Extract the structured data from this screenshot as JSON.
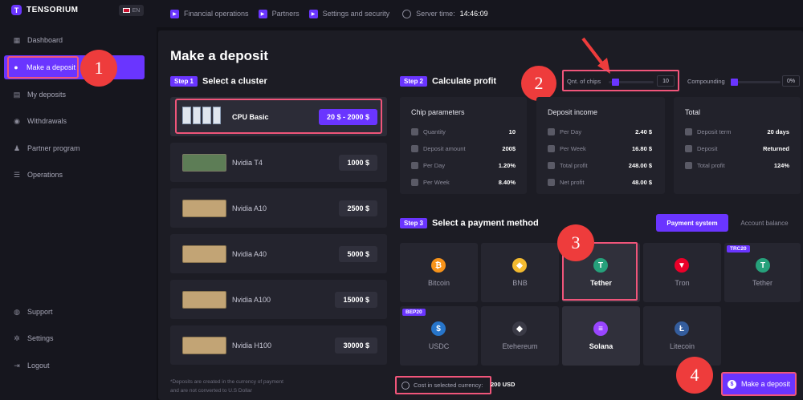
{
  "app": {
    "name": "TENSORIUM",
    "lang": "EN"
  },
  "sidebar": {
    "items": [
      {
        "label": "Dashboard",
        "icon": "dashboard-icon"
      },
      {
        "label": "Make a deposit",
        "icon": "deposit-icon",
        "active": true
      },
      {
        "label": "My deposits",
        "icon": "wallet-icon"
      },
      {
        "label": "Withdrawals",
        "icon": "withdraw-icon"
      },
      {
        "label": "Partner program",
        "icon": "users-icon"
      },
      {
        "label": "Operations",
        "icon": "list-icon"
      }
    ],
    "bottom": [
      {
        "label": "Support",
        "icon": "support-icon"
      },
      {
        "label": "Settings",
        "icon": "gear-icon"
      },
      {
        "label": "Logout",
        "icon": "logout-icon"
      }
    ]
  },
  "topbar": {
    "links": [
      "Financial operations",
      "Partners",
      "Settings and security"
    ],
    "server_time_label": "Server time:",
    "server_time": "14:46:09"
  },
  "page": {
    "title": "Make a deposit"
  },
  "step1": {
    "tag": "Step 1",
    "title": "Select a cluster"
  },
  "clusters": [
    {
      "name": "CPU Basic",
      "price": "20 $ - 2000 $",
      "selected": true
    },
    {
      "name": "Nvidia T4",
      "price": "1000 $"
    },
    {
      "name": "Nvidia A10",
      "price": "2500 $"
    },
    {
      "name": "Nvidia A40",
      "price": "5000 $"
    },
    {
      "name": "Nvidia A100",
      "price": "15000 $"
    },
    {
      "name": "Nvidia H100",
      "price": "30000 $"
    }
  ],
  "step2": {
    "tag": "Step 2",
    "title": "Calculate profit"
  },
  "controls": {
    "chips_label": "Qnt. of chips",
    "chips_value": "10",
    "compounding_label": "Compounding",
    "compounding_value": "0%"
  },
  "panels": {
    "chip": {
      "title": "Chip parameters",
      "rows": [
        {
          "label": "Quantity",
          "value": "10"
        },
        {
          "label": "Deposit amount",
          "value": "200$"
        },
        {
          "label": "Per Day",
          "value": "1.20%"
        },
        {
          "label": "Per Week",
          "value": "8.40%"
        }
      ]
    },
    "income": {
      "title": "Deposit income",
      "rows": [
        {
          "label": "Per Day",
          "value": "2.40 $"
        },
        {
          "label": "Per Week",
          "value": "16.80 $"
        },
        {
          "label": "Total profit",
          "value": "248.00 $"
        },
        {
          "label": "Net profit",
          "value": "48.00 $"
        }
      ]
    },
    "total": {
      "title": "Total",
      "rows": [
        {
          "label": "Deposit term",
          "value": "20 days"
        },
        {
          "label": "Deposit",
          "value": "Returned"
        },
        {
          "label": "Total profit",
          "value": "124%"
        }
      ]
    }
  },
  "step3": {
    "tag": "Step 3",
    "title": "Select a payment method"
  },
  "payment_tabs": [
    "Payment system",
    "Account balance"
  ],
  "payments": [
    {
      "name": "Bitcoin",
      "glyph": "₿",
      "color": "#f7931a"
    },
    {
      "name": "BNB",
      "glyph": "◆",
      "color": "#f3ba2f"
    },
    {
      "name": "Tether",
      "glyph": "T",
      "color": "#26a17b",
      "selected": true
    },
    {
      "name": "Tron",
      "glyph": "▼",
      "color": "#eb0029"
    },
    {
      "name": "Tether",
      "glyph": "T",
      "color": "#26a17b",
      "network": "TRC20"
    },
    {
      "name": "USDC",
      "glyph": "$",
      "color": "#2775ca",
      "network": "BEP20"
    },
    {
      "name": "Etehereum",
      "glyph": "◆",
      "color": "#3a3a46"
    },
    {
      "name": "Solana",
      "glyph": "≡",
      "color": "#9945ff"
    },
    {
      "name": "Litecoin",
      "glyph": "Ł",
      "color": "#345d9d"
    }
  ],
  "footer": {
    "note_line1": "*Deposits are created in the currency of payment",
    "note_line2": "and are not converted to U.S Dollar",
    "cost_label": "Cost in selected currency:",
    "cost_value": "200 USD",
    "deposit_button": "Make a deposit"
  },
  "annotations": [
    "1",
    "2",
    "3",
    "4"
  ],
  "colors": {
    "accent": "#6a35ff",
    "highlight": "#f0557a",
    "marker": "#ee3c3c"
  }
}
